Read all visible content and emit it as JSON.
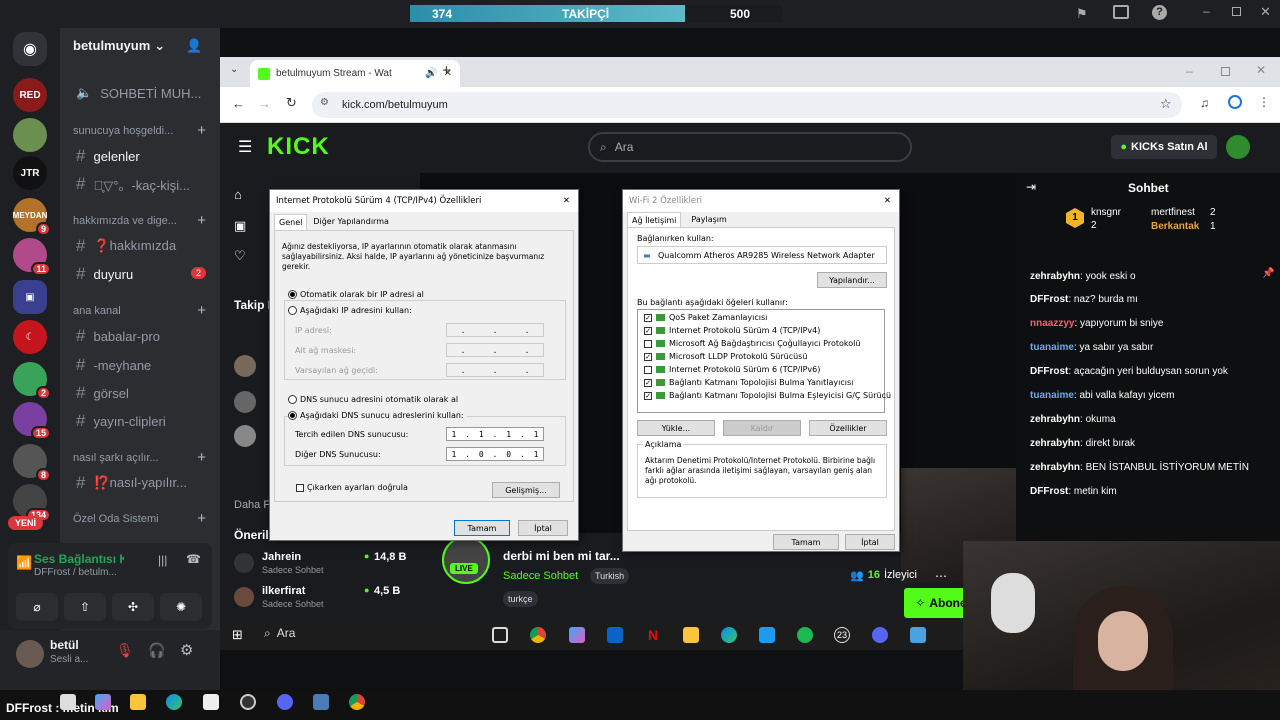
{
  "stream_bar": {
    "followers_current": "374",
    "followers_label": "TAKİPÇİ",
    "followers_goal": "500"
  },
  "discord": {
    "server_name": "betulmuyum",
    "top_channel": "SOHBETİ MUH...",
    "categories": [
      "sunucuya hoşgeldi...",
      "hakkımızda ve dige...",
      "ana kanal",
      "nasıl şarkı açılır...",
      "Özel Oda Sistemi"
    ],
    "channels": [
      {
        "label": "gelenler",
        "active": true
      },
      {
        "label": "。̥▽°。-kaç-kişi...",
        "active": false
      },
      {
        "label": "❓hakkımızda",
        "active": false
      },
      {
        "label": "duyuru",
        "active": true,
        "badge": "2"
      },
      {
        "label": "babalar-pro",
        "active": false
      },
      {
        "label": "-meyhane",
        "active": false
      },
      {
        "label": "görsel",
        "active": false
      },
      {
        "label": "yayın-clipleri",
        "active": false
      },
      {
        "label": "⁉️nasıl-yapılır...",
        "active": false
      }
    ],
    "server_badges": [
      "9",
      "11",
      "2",
      "15",
      "8",
      "134"
    ],
    "new_label": "YENİ",
    "voice": {
      "status": "Ses Bağlantısı K",
      "channel": "DFFrost / betulm..."
    },
    "user": {
      "name": "betül",
      "status": "Sesli a..."
    }
  },
  "browser": {
    "tab_title": "betulmuyum Stream - Wat",
    "url": "kick.com/betulmuyum"
  },
  "kick": {
    "search_placeholder": "Ara",
    "buy_label": "KICKs Satın Al",
    "chat_title": "Sohbet",
    "top_gifters": [
      {
        "name": "knsgnr",
        "count": "2"
      },
      {
        "name": "mertfinest",
        "count": "2"
      },
      {
        "name": "Berkantak",
        "count": "1"
      }
    ],
    "chat_messages": [
      {
        "user": "zehrabyhn",
        "text": "yook eski o",
        "color": "#ffffff"
      },
      {
        "user": "DFFrost",
        "text": "naz? burda mı",
        "color": "#ffffff"
      },
      {
        "user": "nnaazzyy",
        "text": "yapıyorum bi sniye",
        "color": "#ff5a7a"
      },
      {
        "user": "tuanaime",
        "text": "ya sabır ya sabır",
        "color": "#6aa6ff"
      },
      {
        "user": "DFFrost",
        "text": "açacağın yeri bulduysan sorun yok",
        "color": "#ffffff"
      },
      {
        "user": "tuanaime",
        "text": "abi valla kafayı yicem",
        "color": "#6aa6ff"
      },
      {
        "user": "zehrabyhn",
        "text": "okuma",
        "color": "#ffffff"
      },
      {
        "user": "zehrabyhn",
        "text": "direkt bırak",
        "color": "#ffffff"
      },
      {
        "user": "zehrabyhn",
        "text": "BEN İSTANBUL İSTİYORUM METİN",
        "color": "#ffffff"
      },
      {
        "user": "DFFrost",
        "text": "metin kim",
        "color": "#ffffff"
      }
    ],
    "subscribe_label": "Abone Ol",
    "follows_label": "Takip E",
    "recommended_label": "Öneril",
    "more_label": "Daha Fa",
    "recommended": [
      {
        "name": "Jahrein",
        "category": "Sadece Sohbet",
        "viewers": "14,8 B"
      },
      {
        "name": "ilkerfirat",
        "category": "Sadece Sohbet",
        "viewers": "4,5 B"
      }
    ],
    "stream": {
      "title": "derbi mi ben mi tar...",
      "category": "Sadece Sohbet",
      "tags": [
        "Turkish",
        "turkçe"
      ],
      "viewers": "16",
      "viewers_label": "İzleyici",
      "live": "LIVE"
    }
  },
  "ipv4_dialog": {
    "title": "Internet Protokolü Sürüm 4 (TCP/IPv4) Özellikleri",
    "tabs": [
      "Genel",
      "Diğer Yapılandırma"
    ],
    "description": "Ağınız destekliyorsa, IP ayarlarının otomatik olarak atanmasını sağlayabilirsiniz. Aksi halde, IP ayarlarını ağ yöneticinize başvurmanız gerekir.",
    "auto_ip": "Otomatik olarak bir IP adresi al",
    "manual_ip": "Aşağıdaki IP adresini kullan:",
    "ip_label": "IP adresi:",
    "mask_label": "Alt ağ maskesi:",
    "gateway_label": "Varsayılan ağ geçidi:",
    "auto_dns": "DNS sunucu adresini otomatik olarak al",
    "manual_dns": "Aşağıdaki DNS sunucu adreslerini kullan:",
    "preferred_dns_label": "Tercih edilen DNS sunucusu:",
    "preferred_dns": [
      "1",
      "1",
      "1",
      "1"
    ],
    "alternate_dns_label": "Diğer DNS Sunucusu:",
    "alternate_dns": [
      "1",
      "0",
      "0",
      "1"
    ],
    "validate": "Çıkarken ayarları doğrula",
    "advanced": "Gelişmiş...",
    "ok": "Tamam",
    "cancel": "İptal"
  },
  "wifi_dialog": {
    "title": "Wi-Fi 2 Özellikleri",
    "behind_title": "Wi-Fi 2 Durumu",
    "tabs": [
      "Ağ İletişimi",
      "Paylaşım"
    ],
    "connect_using": "Bağlanırken kullan:",
    "adapter": "Qualcomm Atheros AR9285 Wireless Network Adapter",
    "configure": "Yapılandır...",
    "items_label": "Bu bağlantı aşağıdaki öğeleri kullanır:",
    "items": [
      {
        "label": "QoS Paket Zamanlayıcısı",
        "checked": true
      },
      {
        "label": "Internet Protokolü Sürüm 4 (TCP/IPv4)",
        "checked": true
      },
      {
        "label": "Microsoft Ağ Bağdaştırıcısı Çoğullayıcı Protokolü",
        "checked": false
      },
      {
        "label": "Microsoft LLDP Protokolü Sürücüsü",
        "checked": true
      },
      {
        "label": "Internet Protokolü Sürüm 6 (TCP/IPv6)",
        "checked": false
      },
      {
        "label": "Bağlantı Katmanı Topolojisi Bulma Yanıtlayıcısı",
        "checked": true
      },
      {
        "label": "Bağlantı Katmanı Topolojisi Bulma Eşleyicisi G/Ç Sürücü",
        "checked": true
      }
    ],
    "install": "Yükle...",
    "uninstall": "Kaldır",
    "properties": "Özellikler",
    "desc_label": "Açıklama",
    "desc": "Aktarım Denetimi Protokolü/Internet Protokolü. Birbirine bağlı farklı ağlar arasında iletişimi sağlayan, varsayılan geniş alan ağı protokolü.",
    "ok": "Tamam",
    "cancel": "İptal"
  },
  "taskbar": {
    "search": "Ara"
  },
  "overlay": {
    "caption": "DFFrost : metin kim",
    "badge_23": "23"
  }
}
